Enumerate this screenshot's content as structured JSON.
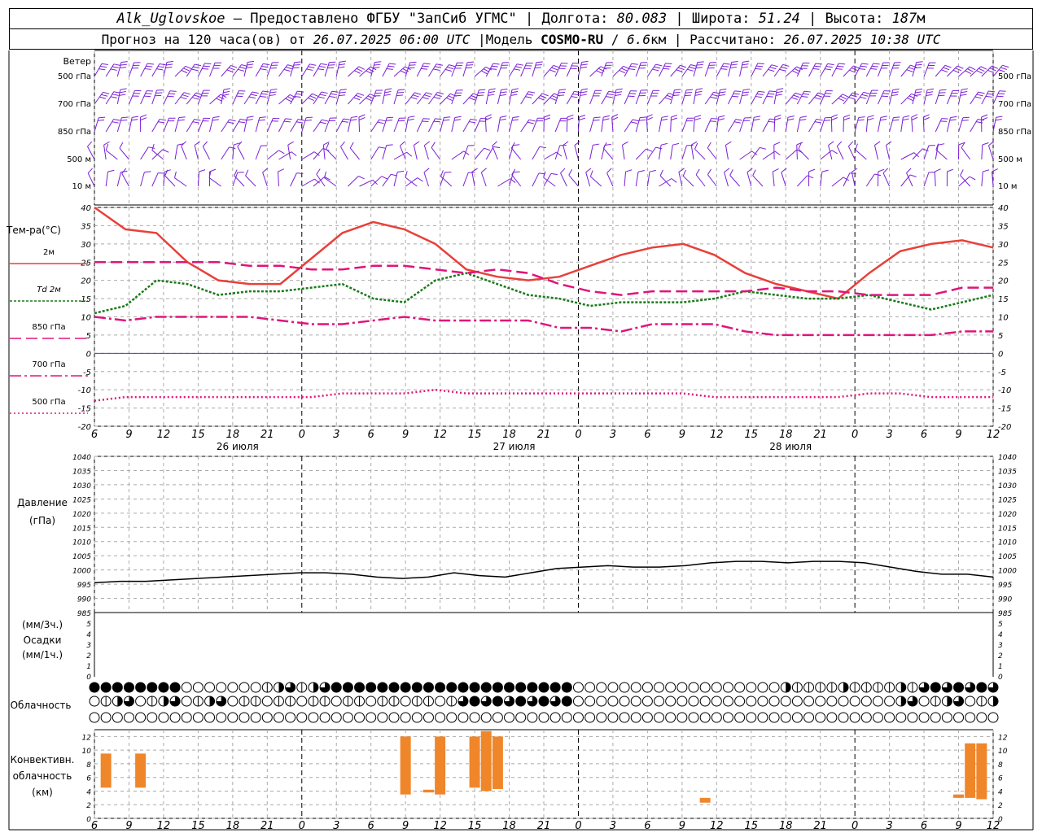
{
  "header": {
    "station": "Alk_Uglovskoe",
    "dash": "–",
    "provider": "Предоставлено ФГБУ \"ЗапСиб УГМС\"",
    "sep": "|",
    "lon_label": "Долгота:",
    "lon_value": "80.083",
    "lat_label": "Широта:",
    "lat_value": "51.24",
    "alt_label": "Высота:",
    "alt_value": "187",
    "alt_unit": "м",
    "forecast_prefix": "Прогноз на 120 часа(ов) от",
    "forecast_time": "26.07.2025 06:00 UTC",
    "model_label": "Модель",
    "model_name": "COSMO-RU",
    "model_sep": "/",
    "model_res": "6.6",
    "model_res_unit": "км",
    "calc_label": "Рассчитано:",
    "calc_time": "26.07.2025 10:38 UTC"
  },
  "wind": {
    "title": "Ветер",
    "levels": [
      "500 гПа",
      "700 гПа",
      "850 гПа",
      "500 м",
      "10  м"
    ],
    "color": "#7b1fd6"
  },
  "time_axis": {
    "hour_labels": [
      6,
      9,
      12,
      15,
      18,
      21,
      0,
      3,
      6,
      9,
      12,
      15,
      18,
      21,
      0,
      3,
      6,
      9,
      12,
      15,
      18,
      21,
      0,
      3,
      6,
      9,
      12
    ],
    "day_labels": [
      {
        "text": "26 июля",
        "hour": 12
      },
      {
        "text": "27 июля",
        "hour": 36
      },
      {
        "text": "28 июля",
        "hour": 60
      }
    ]
  },
  "temperature": {
    "title": "Тем-ра(°С)",
    "legend": [
      {
        "label": "2м",
        "color": "#e8403a",
        "style": "solid"
      },
      {
        "label": "Td 2м",
        "color": "#1a7a1a",
        "style": "dotted"
      },
      {
        "label": "850 гПа",
        "color": "#e0157a",
        "style": "dash"
      },
      {
        "label": "700 гПа",
        "color": "#e0157a",
        "style": "dashdot"
      },
      {
        "label": "500 гПа",
        "color": "#e0157a",
        "style": "dot"
      }
    ]
  },
  "pressure": {
    "title": "Давление",
    "unit": "(гПа)"
  },
  "precip": {
    "unit3": "(мм/3ч.)",
    "title": "Осадки",
    "unit1": "(мм/1ч.)"
  },
  "clouds": {
    "title": "Облачность"
  },
  "convective": {
    "title1": "Конвективн.",
    "title2": "облачность",
    "unit": "(км)",
    "color": "#f0862a"
  },
  "chart_data": [
    {
      "type": "line",
      "title": "Тем-ра(°С)",
      "x_hours_from_start": [
        0,
        3,
        6,
        9,
        12,
        15,
        18,
        21,
        24,
        27,
        30,
        33,
        36,
        39,
        42,
        45,
        48,
        51,
        54,
        57,
        60,
        63,
        66,
        69,
        72,
        75,
        78
      ],
      "ylim": [
        -20,
        40
      ],
      "y_ticks": [
        40,
        35,
        30,
        25,
        20,
        15,
        10,
        5,
        0,
        -5,
        -10,
        -15,
        -20
      ],
      "series": [
        {
          "name": "2м",
          "values": [
            40,
            34,
            33,
            25,
            20,
            19,
            19,
            26,
            33,
            36,
            34,
            30,
            23,
            21,
            20,
            21,
            24,
            27,
            29,
            30,
            27,
            22,
            19,
            17,
            15,
            22,
            28,
            30,
            31,
            29
          ]
        },
        {
          "name": "Td 2м",
          "values": [
            11,
            13,
            20,
            19,
            16,
            17,
            17,
            18,
            19,
            15,
            14,
            20,
            22,
            19,
            16,
            15,
            13,
            14,
            14,
            14,
            15,
            17,
            16,
            15,
            15,
            16,
            14,
            12,
            14,
            16
          ]
        },
        {
          "name": "850 гПа",
          "values": [
            25,
            25,
            25,
            25,
            25,
            24,
            24,
            23,
            23,
            24,
            24,
            23,
            22,
            23,
            22,
            19,
            17,
            16,
            17,
            17,
            17,
            17,
            18,
            17,
            17,
            16,
            16,
            16,
            18,
            18
          ]
        },
        {
          "name": "700 гПа",
          "values": [
            10,
            9,
            10,
            10,
            10,
            10,
            9,
            8,
            8,
            9,
            10,
            9,
            9,
            9,
            9,
            7,
            7,
            6,
            8,
            8,
            8,
            6,
            5,
            5,
            5,
            5,
            5,
            5,
            6,
            6
          ]
        },
        {
          "name": "500 гПа",
          "values": [
            -13,
            -12,
            -12,
            -12,
            -12,
            -12,
            -12,
            -12,
            -11,
            -11,
            -11,
            -10,
            -11,
            -11,
            -11,
            -11,
            -11,
            -11,
            -11,
            -11,
            -12,
            -12,
            -12,
            -12,
            -12,
            -11,
            -11,
            -12,
            -12,
            -12
          ]
        }
      ]
    },
    {
      "type": "line",
      "title": "Давление",
      "ylim": [
        985,
        1040
      ],
      "y_ticks": [
        1040,
        1035,
        1030,
        1025,
        1020,
        1015,
        1010,
        1005,
        1000,
        995,
        990,
        985
      ],
      "series": [
        {
          "name": "",
          "values": [
            995.5,
            996,
            996,
            996.5,
            997,
            997.5,
            998,
            998.5,
            999,
            999,
            998.5,
            997.5,
            997,
            997.5,
            999,
            998,
            997.5,
            999,
            1000.5,
            1001,
            1001.5,
            1001,
            1001,
            1001.5,
            1002.5,
            1003,
            1003,
            1002.5,
            1003,
            1003,
            1002.5,
            1001,
            999.5,
            998.5,
            998.5,
            997.5
          ]
        }
      ]
    },
    {
      "type": "bar",
      "title": "Осадки",
      "ylim": [
        0,
        5
      ],
      "y_ticks": [
        5,
        4,
        3,
        2,
        1,
        0
      ],
      "values": []
    },
    {
      "type": "bar",
      "title": "Конвективн. облачность (км)",
      "ylim": [
        0,
        13
      ],
      "y_ticks": [
        12,
        10,
        8,
        6,
        4,
        2,
        0
      ],
      "bars": [
        {
          "hour": 1,
          "base": 4.5,
          "top": 9.5
        },
        {
          "hour": 4,
          "base": 4.5,
          "top": 9.5
        },
        {
          "hour": 27,
          "base": 3.5,
          "top": 12
        },
        {
          "hour": 29,
          "base": 3.8,
          "top": 4.2
        },
        {
          "hour": 30,
          "base": 3.5,
          "top": 12
        },
        {
          "hour": 33,
          "base": 4.5,
          "top": 12
        },
        {
          "hour": 34,
          "base": 4.0,
          "top": 12.8
        },
        {
          "hour": 35,
          "base": 4.3,
          "top": 12
        },
        {
          "hour": 53,
          "base": 2.3,
          "top": 3
        },
        {
          "hour": 75,
          "base": 3,
          "top": 3.5
        },
        {
          "hour": 76,
          "base": 3,
          "top": 11
        },
        {
          "hour": 77,
          "base": 2.8,
          "top": 11
        }
      ]
    }
  ]
}
